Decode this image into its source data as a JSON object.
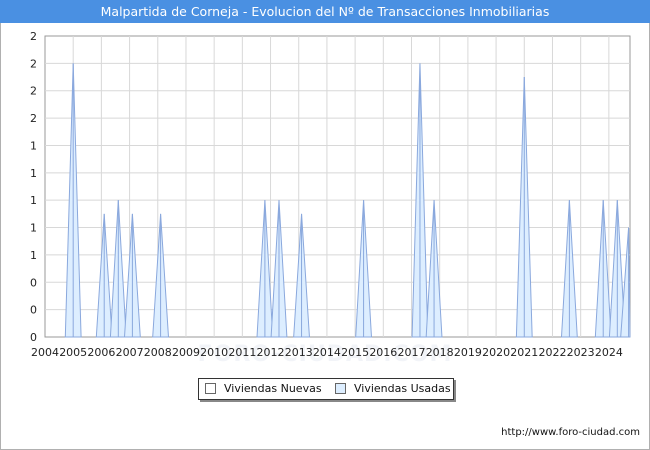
{
  "title": "Malpartida de Corneja - Evolucion del Nº de Transacciones Inmobiliarias",
  "watermark": "FORO-CIUDAD.COM",
  "source": "http://www.foro-ciudad.com",
  "colors": {
    "title_bg": "#4a90e2",
    "nuevas_fill": "#ffffff",
    "usadas_fill": "#ddeeff",
    "usadas_line": "#8aa8dd",
    "grid": "#d8d8d8"
  },
  "chart_data": {
    "type": "area",
    "x_start": "2004-01",
    "x_end": "2024-09",
    "ylim": [
      0,
      2.2
    ],
    "y_tick_labels": [
      "0",
      "0",
      "0",
      "1",
      "1",
      "1",
      "1",
      "1",
      "2",
      "2",
      "2",
      "2"
    ],
    "x_tick_labels": [
      "2004",
      "2005",
      "2006",
      "2007",
      "2008",
      "2009",
      "2010",
      "2011",
      "2012",
      "2013",
      "2014",
      "2015",
      "2016",
      "2017",
      "2018",
      "2019",
      "2020",
      "2021",
      "2022",
      "2023",
      "2024"
    ],
    "grid": true,
    "legend_position": "bottom",
    "series": [
      {
        "name": "Viviendas Nuevas",
        "points": []
      },
      {
        "name": "Viviendas Usadas",
        "points": [
          {
            "x": 2005.0,
            "y": 2.0
          },
          {
            "x": 2006.1,
            "y": 0.9
          },
          {
            "x": 2006.6,
            "y": 1.0
          },
          {
            "x": 2007.1,
            "y": 0.9
          },
          {
            "x": 2008.1,
            "y": 0.9
          },
          {
            "x": 2011.8,
            "y": 1.0
          },
          {
            "x": 2012.3,
            "y": 1.0
          },
          {
            "x": 2013.1,
            "y": 0.9
          },
          {
            "x": 2015.3,
            "y": 1.0
          },
          {
            "x": 2017.3,
            "y": 2.0
          },
          {
            "x": 2017.8,
            "y": 1.0
          },
          {
            "x": 2021.0,
            "y": 1.9
          },
          {
            "x": 2022.6,
            "y": 1.0
          },
          {
            "x": 2023.8,
            "y": 1.0
          },
          {
            "x": 2024.3,
            "y": 1.0
          },
          {
            "x": 2024.7,
            "y": 0.8
          }
        ]
      }
    ]
  }
}
